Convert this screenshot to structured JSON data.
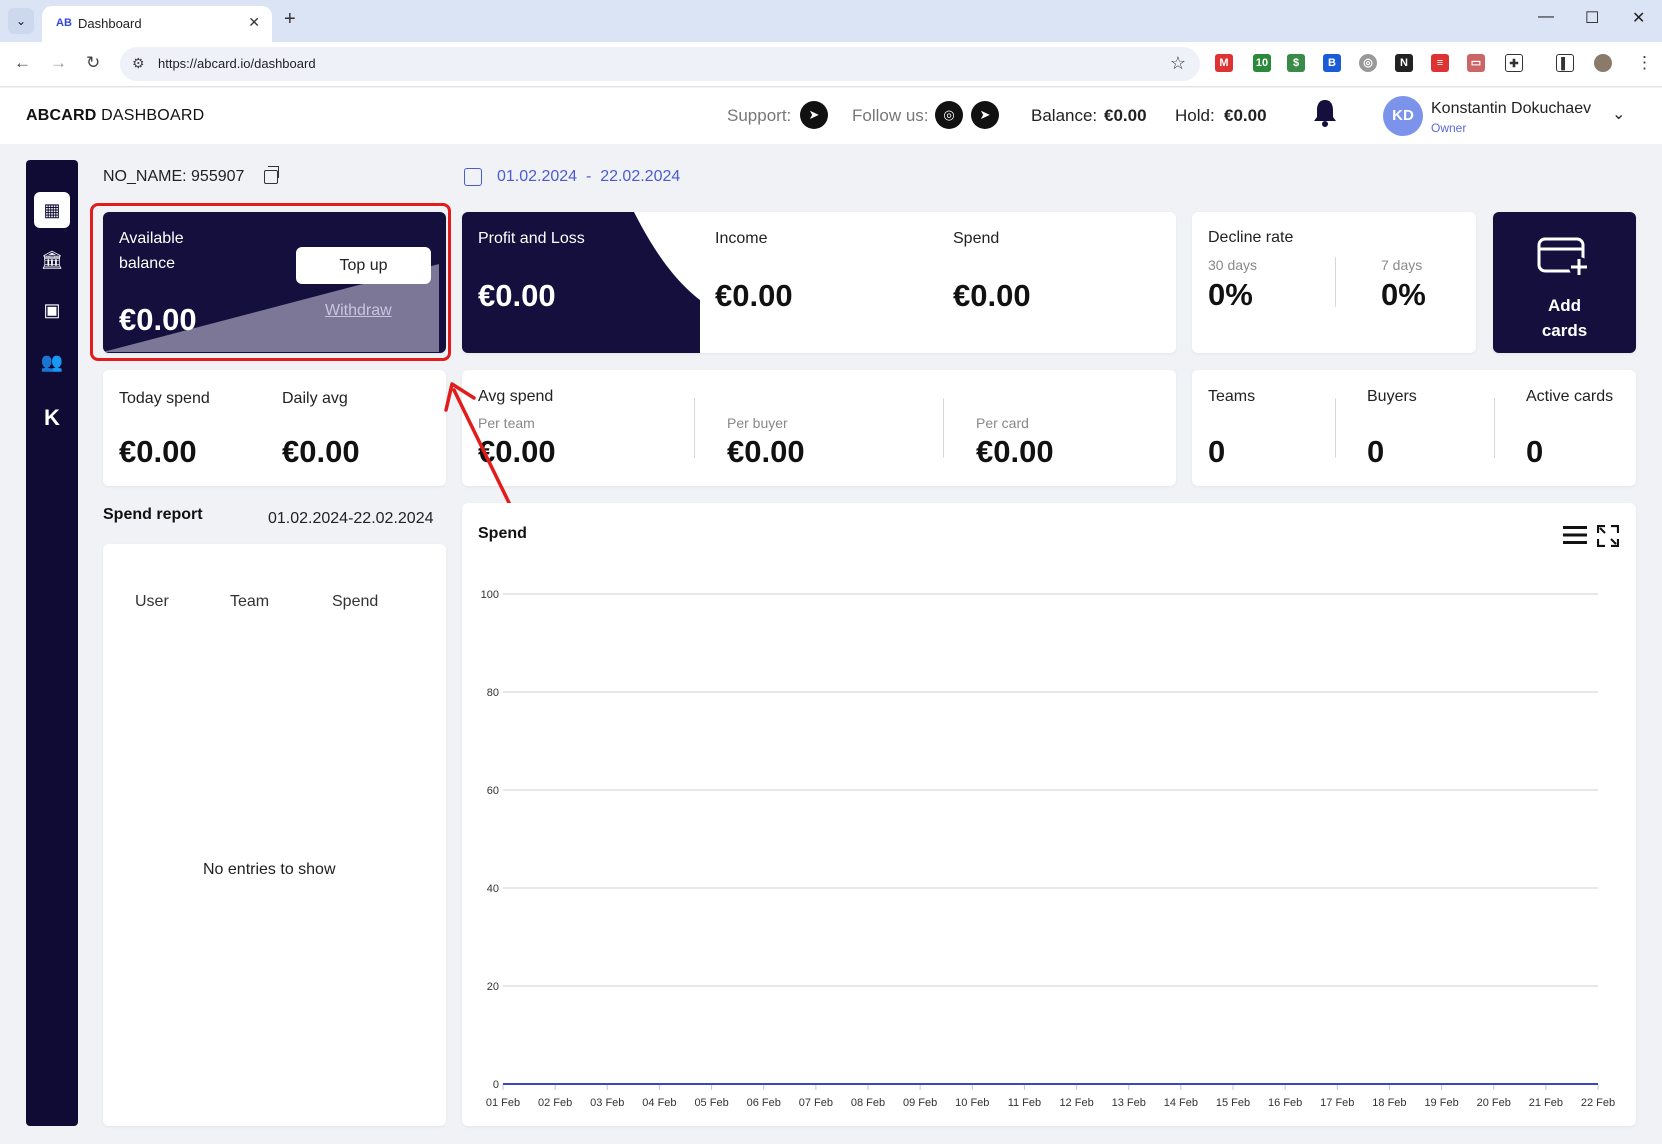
{
  "browser": {
    "tab_title": "Dashboard",
    "tab_favicon": "AB",
    "url": "https://abcard.io/dashboard"
  },
  "header": {
    "brand_bold": "ABCARD",
    "brand_rest": " DASHBOARD",
    "support_label": "Support:",
    "follow_label": "Follow us:",
    "balance_label": "Balance:",
    "balance_value": "€0.00",
    "hold_label": "Hold:",
    "hold_value": "€0.00",
    "user_initials": "KD",
    "user_name": "Konstantin Dokuchaev",
    "user_role": "Owner"
  },
  "sidebar": {
    "items": [
      {
        "icon": "dashboard-icon",
        "glyph": "▦"
      },
      {
        "icon": "bank-icon",
        "glyph": "🏛"
      },
      {
        "icon": "wallet-icon",
        "glyph": "▣"
      },
      {
        "icon": "team-icon",
        "glyph": "👥"
      },
      {
        "icon": "k-logo-icon",
        "glyph": "K"
      }
    ]
  },
  "account": {
    "name": "NO_NAME: 955907",
    "date_from": "01.02.2024",
    "date_sep": "-",
    "date_to": "22.02.2024"
  },
  "balance_card": {
    "label_line1": "Available",
    "label_line2": "balance",
    "value": "€0.00",
    "topup": "Top up",
    "withdraw": "Withdraw"
  },
  "pnl_card": {
    "label": "Profit and Loss",
    "value": "€0.00",
    "income_label": "Income",
    "income_value": "€0.00",
    "spend_label": "Spend",
    "spend_value": "€0.00"
  },
  "decline_card": {
    "label": "Decline rate",
    "d30_label": "30 days",
    "d30_value": "0%",
    "d7_label": "7 days",
    "d7_value": "0%"
  },
  "add_cards": {
    "line1": "Add",
    "line2": "cards"
  },
  "today_card": {
    "today_label": "Today spend",
    "today_value": "€0.00",
    "avg_label": "Daily avg",
    "avg_value": "€0.00"
  },
  "avg_card": {
    "label": "Avg spend",
    "team_label": "Per team",
    "team_value": "€0.00",
    "buyer_label": "Per buyer",
    "buyer_value": "€0.00",
    "card_label": "Per card",
    "card_value": "€0.00"
  },
  "counts_card": {
    "teams_label": "Teams",
    "teams_value": "0",
    "buyers_label": "Buyers",
    "buyers_value": "0",
    "active_label": "Active cards",
    "active_value": "0"
  },
  "spend_report": {
    "title": "Spend report",
    "range": "01.02.2024-22.02.2024",
    "columns": [
      "User",
      "Team",
      "Spend"
    ],
    "empty": "No entries to show"
  },
  "chart_data": {
    "type": "line",
    "title": "Spend",
    "x": [
      "01 Feb",
      "02 Feb",
      "03 Feb",
      "04 Feb",
      "05 Feb",
      "06 Feb",
      "07 Feb",
      "08 Feb",
      "09 Feb",
      "10 Feb",
      "11 Feb",
      "12 Feb",
      "13 Feb",
      "14 Feb",
      "15 Feb",
      "16 Feb",
      "17 Feb",
      "18 Feb",
      "19 Feb",
      "20 Feb",
      "21 Feb",
      "22 Feb"
    ],
    "series": [
      {
        "values": [
          0,
          0,
          0,
          0,
          0,
          0,
          0,
          0,
          0,
          0,
          0,
          0,
          0,
          0,
          0,
          0,
          0,
          0,
          0,
          0,
          0,
          0
        ],
        "color": "#3a46c8"
      }
    ],
    "yticks": [
      0,
      20,
      40,
      60,
      80,
      100
    ],
    "ylim": [
      0,
      100
    ],
    "grid": true
  },
  "colors": {
    "navy": "#140f3d",
    "accent": "#4a5bd4",
    "highlight": "#e21b1b"
  }
}
